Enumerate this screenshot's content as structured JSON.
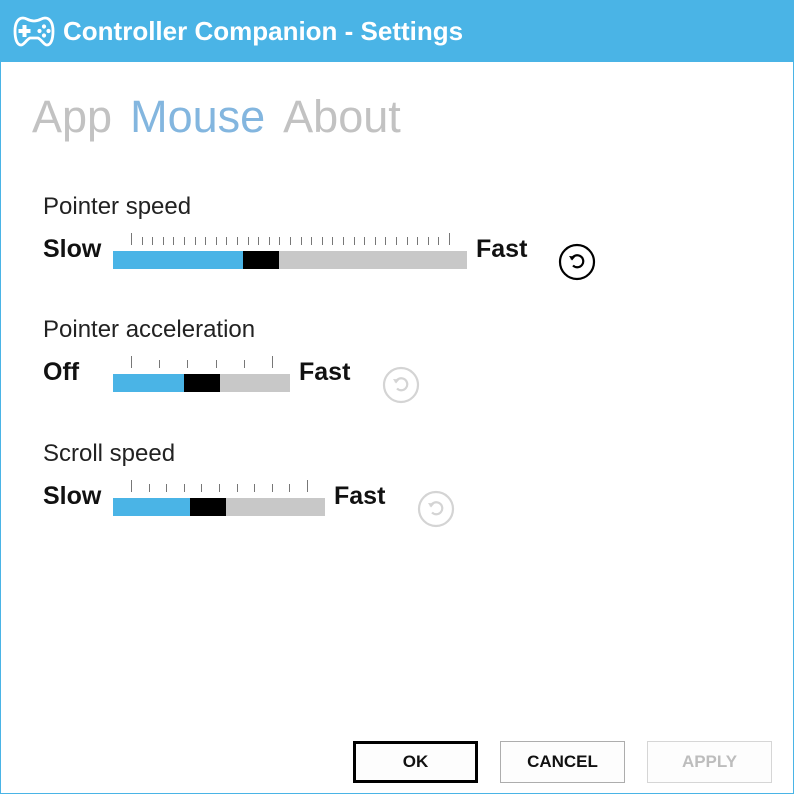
{
  "window": {
    "title": "Controller Companion - Settings",
    "icon": "gamepad-icon",
    "accent_color": "#4ab4e6"
  },
  "tabs": [
    {
      "label": "App",
      "active": false
    },
    {
      "label": "Mouse",
      "active": true
    },
    {
      "label": "About",
      "active": false
    }
  ],
  "settings": {
    "pointer_speed": {
      "label": "Pointer speed",
      "min_label": "Slow",
      "max_label": "Fast",
      "value": 0.41,
      "reset_icon": "reset-icon",
      "reset_enabled": true
    },
    "pointer_acceleration": {
      "label": "Pointer acceleration",
      "min_label": "Off",
      "max_label": "Fast",
      "value": 0.5,
      "reset_icon": "reset-icon",
      "reset_enabled": false
    },
    "scroll_speed": {
      "label": "Scroll speed",
      "min_label": "Slow",
      "max_label": "Fast",
      "value": 0.44,
      "reset_icon": "reset-icon",
      "reset_enabled": false
    }
  },
  "buttons": {
    "ok": "OK",
    "cancel": "CANCEL",
    "apply": "APPLY",
    "apply_enabled": false
  }
}
